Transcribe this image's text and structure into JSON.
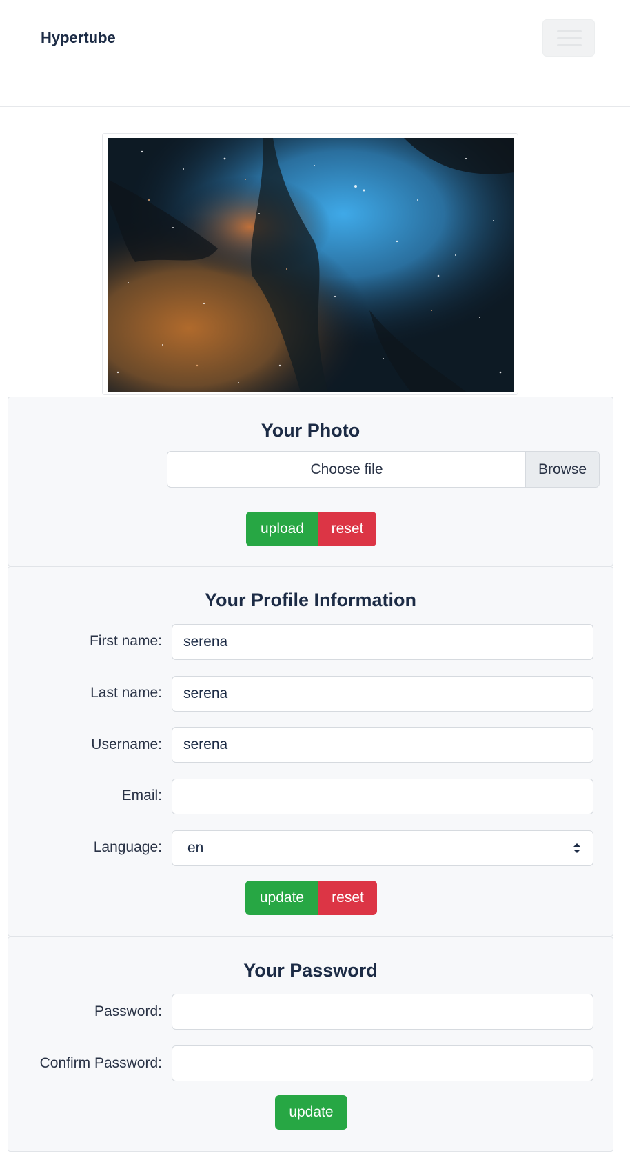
{
  "navbar": {
    "brand": "Hypertube"
  },
  "photo_section": {
    "title": "Your Photo",
    "file_placeholder": "Choose file",
    "browse_label": "Browse",
    "upload_label": "upload",
    "reset_label": "reset"
  },
  "profile_section": {
    "title": "Your Profile Information",
    "first_name_label": "First name:",
    "first_name_value": "serena",
    "last_name_label": "Last name:",
    "last_name_value": "serena",
    "username_label": "Username:",
    "username_value": "serena",
    "email_label": "Email:",
    "email_value": "",
    "language_label": "Language:",
    "language_value": "en",
    "update_label": "update",
    "reset_label": "reset"
  },
  "password_section": {
    "title": "Your Password",
    "password_label": "Password:",
    "confirm_label": "Confirm Password:",
    "update_label": "update"
  },
  "colors": {
    "success": "#27a744",
    "danger": "#dc3545",
    "text": "#1c2b45"
  },
  "icons": [
    "hamburger-menu-icon",
    "select-arrows-icon"
  ]
}
